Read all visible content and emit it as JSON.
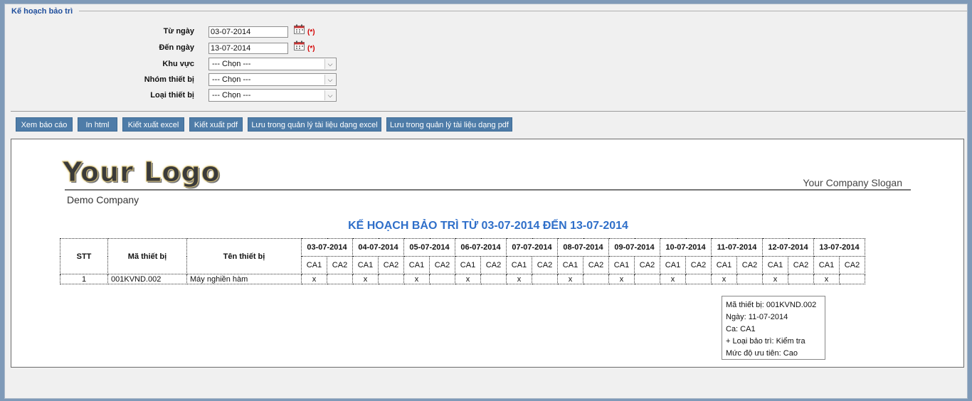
{
  "panel": {
    "title": "Kế hoạch bảo trì"
  },
  "form": {
    "from_label": "Từ ngày",
    "from_value": "03-07-2014",
    "to_label": "Đến ngày",
    "to_value": "13-07-2014",
    "required_mark": "(*)",
    "area_label": "Khu vực",
    "area_value": "--- Chọn ---",
    "group_label": "Nhóm thiết bị",
    "group_value": "--- Chọn ---",
    "type_label": "Loại thiết bị",
    "type_value": "--- Chọn ---"
  },
  "toolbar": {
    "view": "Xem báo cáo",
    "print_html": "In html",
    "export_excel": "Kiết xuất excel",
    "export_pdf": "Kiết xuất pdf",
    "save_excel": "Lưu trong quản lý tài liệu dạng excel",
    "save_pdf": "Lưu trong quản lý tài liệu dạng pdf"
  },
  "report": {
    "logo": "Your Logo",
    "slogan": "Your Company Slogan",
    "company": "Demo Company",
    "title": "KẾ HOẠCH BẢO TRÌ TỪ 03-07-2014 ĐẾN 13-07-2014",
    "headers": {
      "stt": "STT",
      "code": "Mã thiết bị",
      "name": "Tên thiết bị"
    },
    "dates": [
      "03-07-2014",
      "04-07-2014",
      "05-07-2014",
      "06-07-2014",
      "07-07-2014",
      "08-07-2014",
      "09-07-2014",
      "10-07-2014",
      "11-07-2014",
      "12-07-2014",
      "13-07-2014"
    ],
    "shift_labels": [
      "CA1",
      "CA2"
    ],
    "rows": [
      {
        "stt": "1",
        "code": "001KVND.002",
        "name": "Máy nghiền hàm",
        "marks": [
          "x",
          "",
          "x",
          "",
          "x",
          "",
          "x",
          "",
          "x",
          "",
          "x",
          "",
          "x",
          "",
          "x",
          "",
          "x",
          "",
          "x",
          "",
          "x",
          ""
        ]
      }
    ]
  },
  "tooltip": {
    "line1": "Mã thiết bị: 001KVND.002",
    "line2": "Ngày: 11-07-2014",
    "line3": "Ca: CA1",
    "line4": "+ Loại bảo trì: Kiểm tra",
    "line5": "Mức độ ưu tiên: Cao"
  }
}
